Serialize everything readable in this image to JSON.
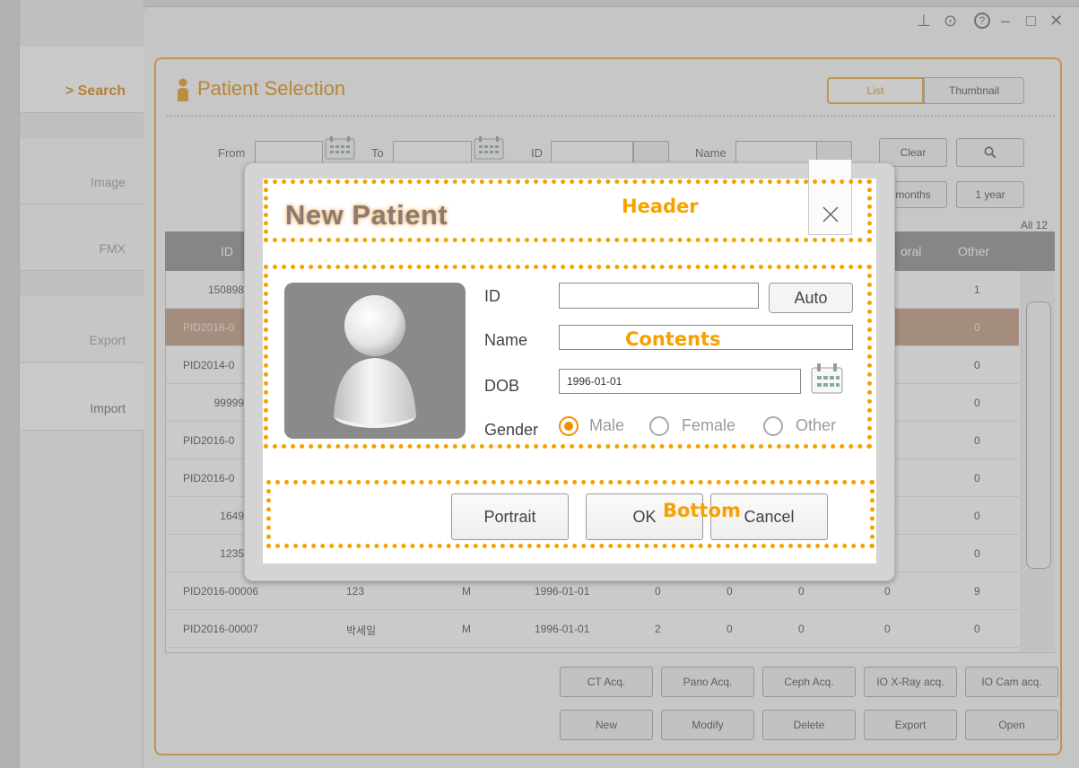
{
  "window_controls": {
    "pin": "⊥",
    "settings": "⊙",
    "help": "?",
    "minimize": "–",
    "maximize": "□",
    "close": "✕"
  },
  "sidebar": {
    "items": [
      {
        "label": "> Search"
      },
      {
        "label": "Image"
      },
      {
        "label": "FMX"
      },
      {
        "label": "Export"
      },
      {
        "label": "Import"
      }
    ]
  },
  "patient_selection": {
    "title": "Patient Selection",
    "view_list": "List",
    "view_thumbnail": "Thumbnail",
    "filters": {
      "from_label": "From",
      "to_label": "To",
      "id_label": "ID",
      "name_label": "Name",
      "clear": "Clear",
      "months": "months",
      "year": "1 year"
    },
    "count_label": "All 12",
    "columns": {
      "id": "ID",
      "oral": "oral",
      "other": "Other"
    },
    "rows": [
      {
        "id": "150898",
        "name": "",
        "gender": "",
        "dob": "",
        "c1": "",
        "c2": "",
        "c3": "",
        "c4": "",
        "other": "1"
      },
      {
        "id": "PID2016-0",
        "name": "",
        "gender": "",
        "dob": "",
        "c1": "",
        "c2": "",
        "c3": "",
        "c4": "",
        "other": "0"
      },
      {
        "id": "PID2014-0",
        "name": "",
        "gender": "",
        "dob": "",
        "c1": "",
        "c2": "",
        "c3": "",
        "c4": "",
        "other": "0"
      },
      {
        "id": "99999",
        "name": "",
        "gender": "",
        "dob": "",
        "c1": "",
        "c2": "",
        "c3": "",
        "c4": "",
        "other": "0"
      },
      {
        "id": "PID2016-0",
        "name": "",
        "gender": "",
        "dob": "",
        "c1": "",
        "c2": "",
        "c3": "",
        "c4": "",
        "other": "0"
      },
      {
        "id": "PID2016-0",
        "name": "",
        "gender": "",
        "dob": "",
        "c1": "",
        "c2": "",
        "c3": "",
        "c4": "",
        "other": "0"
      },
      {
        "id": "1649",
        "name": "",
        "gender": "",
        "dob": "",
        "c1": "",
        "c2": "",
        "c3": "",
        "c4": "",
        "other": "0"
      },
      {
        "id": "1235",
        "name": "",
        "gender": "",
        "dob": "",
        "c1": "",
        "c2": "",
        "c3": "",
        "c4": "",
        "other": "0"
      },
      {
        "id": "PID2016-00006",
        "name": "123",
        "gender": "M",
        "dob": "1996-01-01",
        "c1": "0",
        "c2": "0",
        "c3": "0",
        "c4": "0",
        "other": "9"
      },
      {
        "id": "PID2016-00007",
        "name": "박세일",
        "gender": "M",
        "dob": "1996-01-01",
        "c1": "2",
        "c2": "0",
        "c3": "0",
        "c4": "0",
        "other": "0"
      }
    ],
    "acquire_buttons": [
      "CT Acq.",
      "Pano Acq.",
      "Ceph Acq.",
      "IO X-Ray acq.",
      "IO Cam acq."
    ],
    "action_buttons": [
      "New",
      "Modify",
      "Delete",
      "Export",
      "Open"
    ]
  },
  "new_patient_dialog": {
    "title": "New Patient",
    "annotations": {
      "header": "Header",
      "contents": "Contents",
      "bottom": "Bottom"
    },
    "id_label": "ID",
    "id_value": "",
    "auto_button": "Auto",
    "name_label": "Name",
    "name_value": "",
    "dob_label": "DOB",
    "dob_value": "1996-01-01",
    "gender_label": "Gender",
    "gender_options": [
      "Male",
      "Female",
      "Other"
    ],
    "gender_selected": "Male",
    "buttons": {
      "portrait": "Portrait",
      "ok": "OK",
      "cancel": "Cancel"
    }
  },
  "colors": {
    "accent": "#f0a030",
    "annotation": "#f5a100",
    "selected_row": "#c0967a"
  }
}
